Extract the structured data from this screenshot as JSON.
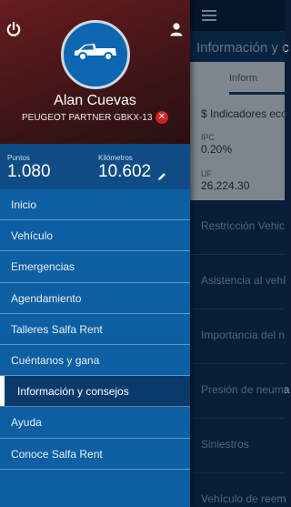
{
  "background_page": {
    "title": "Información y c",
    "tab": "Inform",
    "indicators": {
      "title": "$ Indicadores eco",
      "ipc_label": "IPC",
      "ipc_value": "0.20%",
      "uf_label": "UF",
      "uf_value": "26,224.30"
    },
    "items": [
      "Restricción Vehic",
      "Asistencia al vehí",
      "Importancia del n",
      "Presión de neuma",
      "Siniestros",
      "Vehículo de reem"
    ]
  },
  "drawer": {
    "user_name": "Alan Cuevas",
    "vehicle": "PEUGEOT PARTNER GBKX-13",
    "icons": {
      "power": "power-icon",
      "profile": "user-icon",
      "avatar": "truck-icon",
      "remove": "close-icon",
      "edit": "pencil-icon"
    },
    "stats": {
      "points_label": "Puntos",
      "points_value": "1.080",
      "km_label": "Kilómetros",
      "km_value": "10.602"
    },
    "menu": [
      {
        "label": "Inicio",
        "active": false
      },
      {
        "label": "Vehículo",
        "active": false
      },
      {
        "label": "Emergencias",
        "active": false
      },
      {
        "label": "Agendamiento",
        "active": false
      },
      {
        "label": "Talleres Salfa Rent",
        "active": false
      },
      {
        "label": "Cuéntanos y gana",
        "active": false
      },
      {
        "label": "Información y consejos",
        "active": true
      },
      {
        "label": "Ayuda",
        "active": false
      },
      {
        "label": "Conoce Salfa Rent",
        "active": false
      }
    ]
  },
  "colors": {
    "drawer_bg": "#0d5fa3",
    "active_item": "#0a3a6b",
    "remove_badge": "#d0202a"
  }
}
